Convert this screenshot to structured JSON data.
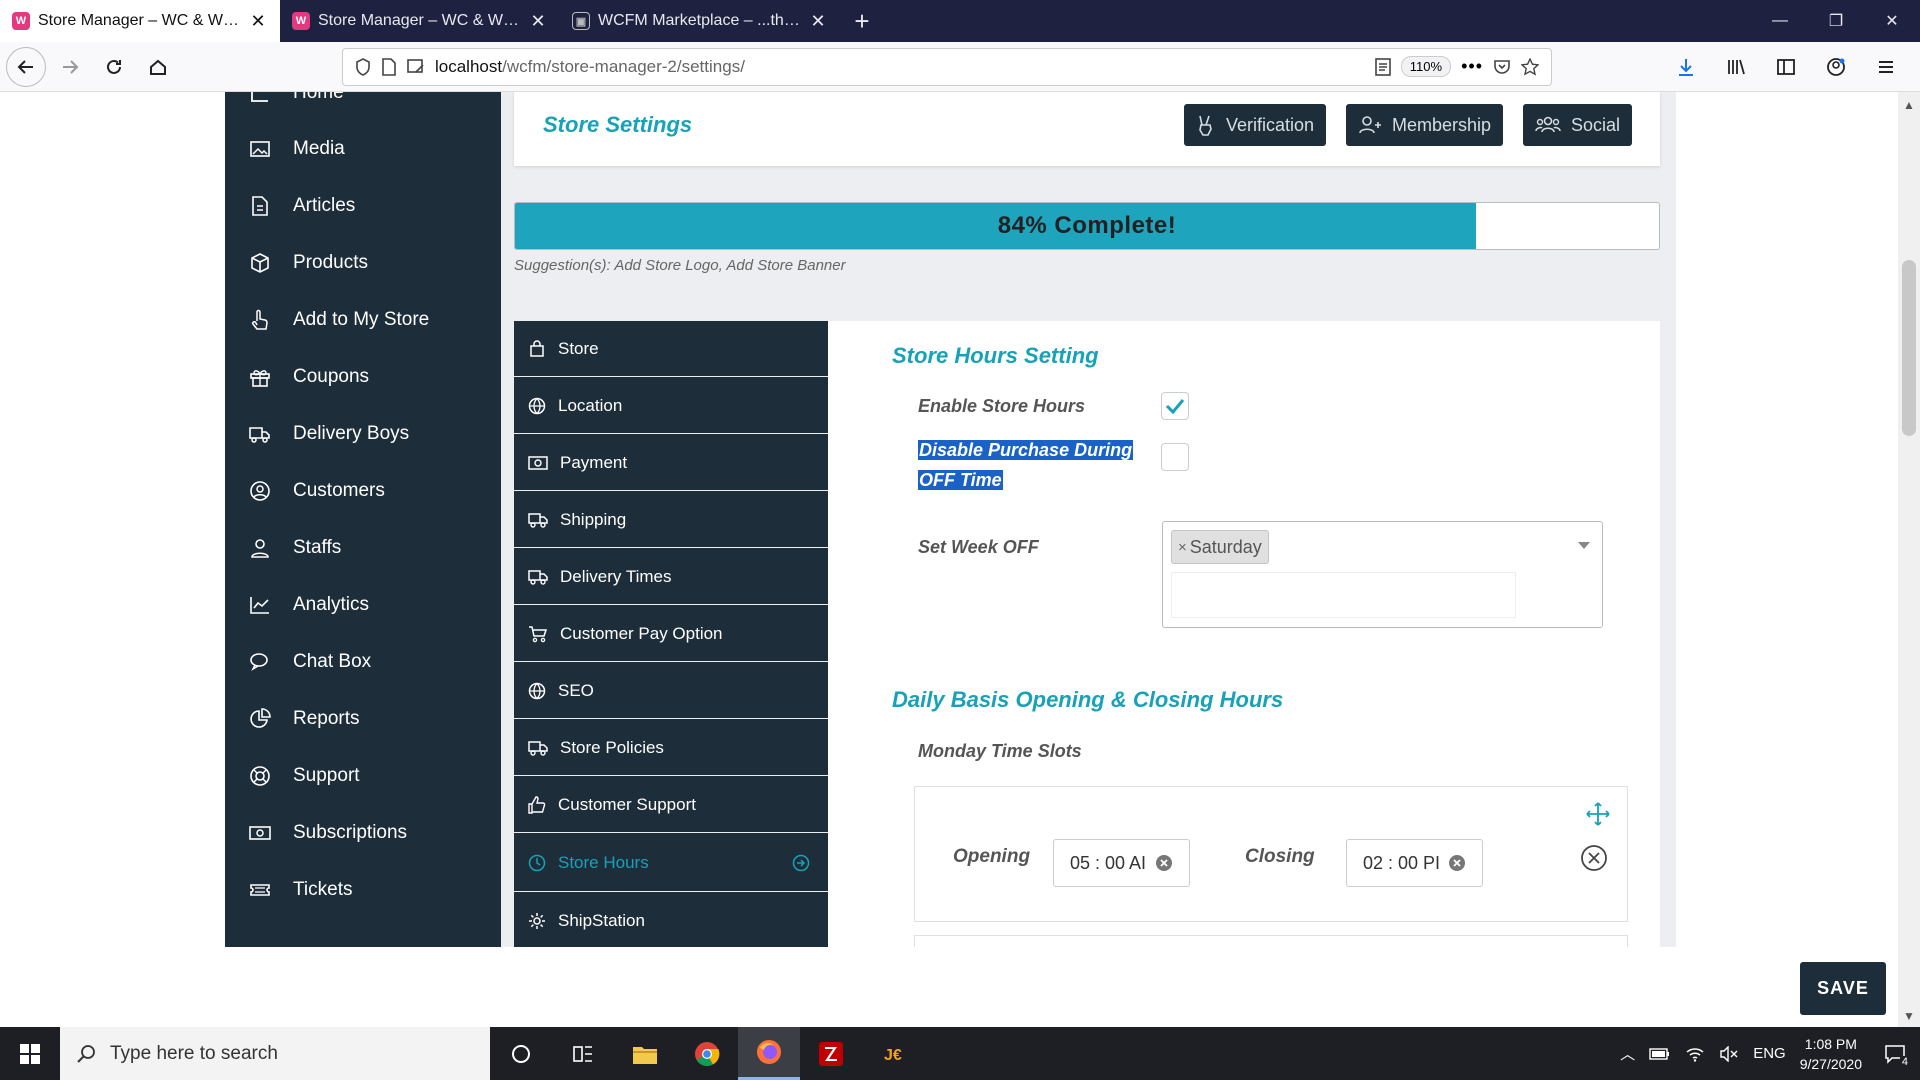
{
  "browser": {
    "tabs": [
      {
        "label": "Store Manager – WC & WCFM",
        "active": true
      },
      {
        "label": "Store Manager – WC & WCFM",
        "active": false
      },
      {
        "label": "WCFM Marketplace – ...the nex",
        "active": false
      }
    ],
    "url_host": "localhost",
    "url_path": "/wcfm/store-manager-2/settings/",
    "zoom": "110%"
  },
  "sidebar": {
    "items": [
      {
        "label": "Home",
        "icon": "home-icon"
      },
      {
        "label": "Media",
        "icon": "media-icon"
      },
      {
        "label": "Articles",
        "icon": "articles-icon"
      },
      {
        "label": "Products",
        "icon": "products-icon"
      },
      {
        "label": "Add to My Store",
        "icon": "hand-pointer-icon"
      },
      {
        "label": "Coupons",
        "icon": "gift-icon"
      },
      {
        "label": "Delivery Boys",
        "icon": "truck-icon"
      },
      {
        "label": "Customers",
        "icon": "user-circle-icon"
      },
      {
        "label": "Staffs",
        "icon": "user-icon"
      },
      {
        "label": "Analytics",
        "icon": "chart-icon"
      },
      {
        "label": "Chat Box",
        "icon": "chat-icon"
      },
      {
        "label": "Reports",
        "icon": "pie-chart-icon"
      },
      {
        "label": "Support",
        "icon": "lifering-icon"
      },
      {
        "label": "Subscriptions",
        "icon": "money-icon"
      },
      {
        "label": "Tickets",
        "icon": "ticket-icon"
      }
    ]
  },
  "header": {
    "title": "Store Settings",
    "buttons": [
      {
        "label": "Verification",
        "icon": "peace-hand-icon"
      },
      {
        "label": "Membership",
        "icon": "user-plus-icon"
      },
      {
        "label": "Social",
        "icon": "users-icon"
      }
    ]
  },
  "progress": {
    "label": "84% Complete!",
    "value": 84,
    "suggestion": "Suggestion(s): Add Store Logo, Add Store Banner"
  },
  "settings_tabs": [
    {
      "label": "Store",
      "icon": "bag-icon"
    },
    {
      "label": "Location",
      "icon": "globe-icon"
    },
    {
      "label": "Payment",
      "icon": "money-icon"
    },
    {
      "label": "Shipping",
      "icon": "truck-icon"
    },
    {
      "label": "Delivery Times",
      "icon": "truck-icon"
    },
    {
      "label": "Customer Pay Option",
      "icon": "cart-icon"
    },
    {
      "label": "SEO",
      "icon": "globe-icon"
    },
    {
      "label": "Store Policies",
      "icon": "truck-icon"
    },
    {
      "label": "Customer Support",
      "icon": "thumbs-up-icon"
    },
    {
      "label": "Store Hours",
      "icon": "clock-icon",
      "active": true
    },
    {
      "label": "ShipStation",
      "icon": "gear-icon"
    }
  ],
  "store_hours": {
    "title": "Store Hours Setting",
    "enable_label": "Enable Store Hours",
    "enable_checked": true,
    "disable_purchase_line1": "Disable Purchase During",
    "disable_purchase_line2": "OFF Time",
    "disable_purchase_checked": false,
    "week_off_label": "Set Week OFF",
    "week_off_selected": "Saturday",
    "daily_title": "Daily Basis Opening & Closing Hours",
    "monday_label": "Monday Time Slots",
    "opening_label": "Opening",
    "opening_value": "05 : 00  AI",
    "closing_label": "Closing",
    "closing_value": "02 : 00  PI"
  },
  "save_label": "SAVE",
  "taskbar": {
    "search_placeholder": "Type here to search",
    "lang": "ENG",
    "time": "1:08 PM",
    "date": "9/27/2020",
    "notif_count": "4"
  }
}
